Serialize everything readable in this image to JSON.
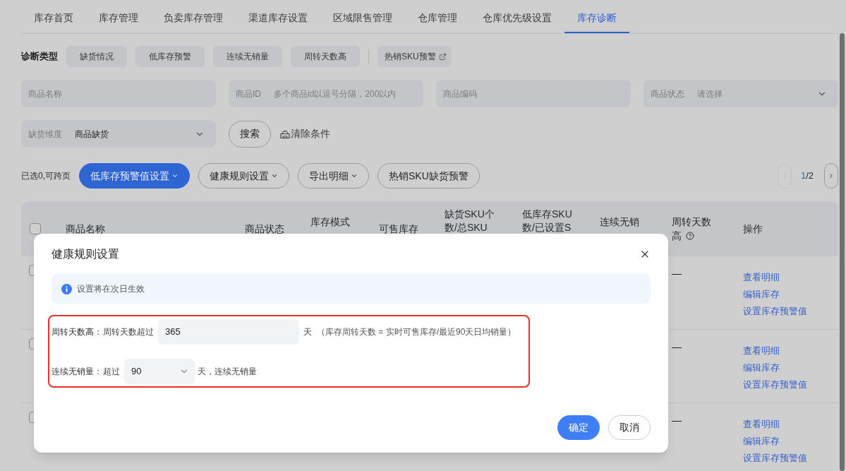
{
  "tabs": [
    {
      "label": "库存首页",
      "selected": false
    },
    {
      "label": "库存管理",
      "selected": false
    },
    {
      "label": "负卖库存管理",
      "selected": false
    },
    {
      "label": "渠道库存设置",
      "selected": false
    },
    {
      "label": "区域限售管理",
      "selected": false
    },
    {
      "label": "仓库管理",
      "selected": false
    },
    {
      "label": "仓库优先级设置",
      "selected": false
    },
    {
      "label": "库存诊断",
      "selected": true
    }
  ],
  "diagnosis_types": {
    "label": "诊断类型",
    "items": [
      {
        "label": "缺货情况",
        "kind": "filter"
      },
      {
        "label": "低库存预警",
        "kind": "filter"
      },
      {
        "label": "连续无销量",
        "kind": "filter"
      },
      {
        "label": "周转天数高",
        "kind": "filter"
      },
      {
        "label": "热销SKU预警",
        "kind": "external"
      }
    ]
  },
  "search_form": {
    "fields": [
      {
        "kind": "text",
        "placeholder": "商品名称"
      },
      {
        "kind": "labeled-text",
        "label": "商品ID",
        "placeholder": "多个商品id以逗号分隔，200以内"
      },
      {
        "kind": "text",
        "placeholder": "商品编码"
      },
      {
        "kind": "select",
        "label": "商品状态",
        "placeholder": "请选择"
      },
      {
        "kind": "select",
        "label": "缺货维度",
        "value": "商品缺货"
      }
    ],
    "search_button": "搜索",
    "clear_button": "清除条件"
  },
  "toolbar": {
    "selection_note": "已选0,可跨页",
    "buttons": [
      {
        "label": "低库存预警值设置",
        "kind": "primary-dropdown"
      },
      {
        "label": "健康规则设置",
        "kind": "dropdown"
      },
      {
        "label": "导出明细",
        "kind": "dropdown"
      },
      {
        "label": "热销SKU缺货预警",
        "kind": "plain"
      }
    ],
    "pagination": {
      "current_page": "1",
      "page_total": "/2",
      "prev": {
        "disabled": true
      },
      "next": {
        "disabled": false
      }
    }
  },
  "table": {
    "header_checkbox": {
      "checked": false
    },
    "columns": [
      {
        "label": "商品名称",
        "help": false
      },
      {
        "label": "商品状态",
        "help": false
      },
      {
        "label": "库存模式",
        "help": false
      },
      {
        "label": "可售库存",
        "help": false
      },
      {
        "label": "缺货SKU个数/总SKU",
        "help": false
      },
      {
        "label": "低库存SKU数/已设置S",
        "help": false
      },
      {
        "label": "连续无销",
        "help": false
      },
      {
        "label": "周转天数高",
        "help": true
      },
      {
        "label": "操作",
        "help": false
      }
    ],
    "rows": [
      {
        "checked": false,
        "turnover_high": "—",
        "actions": [
          "查看明细",
          "编辑库存",
          "设置库存预警值"
        ]
      },
      {
        "checked": false,
        "turnover_high": "—",
        "actions": [
          "查看明细",
          "编辑库存",
          "设置库存预警值"
        ]
      },
      {
        "checked": false,
        "turnover_high": "—",
        "actions": [
          "查看明细",
          "编辑库存",
          "设置库存预警值"
        ]
      }
    ]
  },
  "dialog": {
    "title": "健康规则设置",
    "notice": "设置将在次日生效",
    "highlight": true,
    "rules": [
      {
        "kind": "input",
        "label": "周转天数高：",
        "prefix": "周转天数超过",
        "value": "365",
        "suffix": "天",
        "note": "（库存周转天数 = 实时可售库存/最近90天日均销量）"
      },
      {
        "kind": "select",
        "label": "连续无销量：",
        "prefix": "超过",
        "value": "90",
        "suffix": "天，连续无销量"
      }
    ],
    "buttons": [
      {
        "label": "确定",
        "kind": "primary"
      },
      {
        "label": "取消",
        "kind": "default"
      }
    ]
  }
}
